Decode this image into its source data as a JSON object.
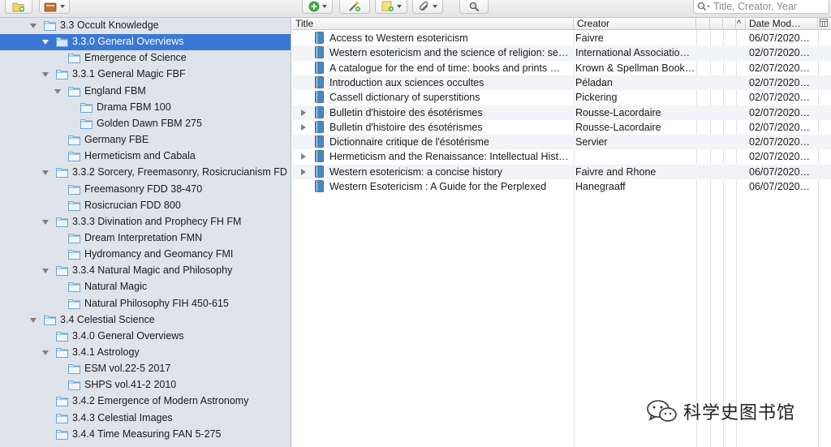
{
  "toolbar": {
    "search_placeholder": "Title, Creator, Year",
    "icons": [
      "new-collection-icon",
      "new-library-icon",
      "new-item-icon",
      "add-by-identifier-icon",
      "new-note-icon",
      "add-attachment-icon",
      "locate-icon",
      "search-icon"
    ]
  },
  "tree": {
    "items": [
      {
        "label": "3.3 Occult Knowledge",
        "depth": 1,
        "expanded": true,
        "selected": false
      },
      {
        "label": "3.3.0 General Overviews",
        "depth": 2,
        "expanded": true,
        "selected": true
      },
      {
        "label": "Emergence of Science",
        "depth": 3,
        "expanded": null,
        "selected": false
      },
      {
        "label": "3.3.1 General Magic FBF",
        "depth": 2,
        "expanded": true,
        "selected": false
      },
      {
        "label": "England FBM",
        "depth": 3,
        "expanded": true,
        "selected": false
      },
      {
        "label": "Drama FBM 100",
        "depth": 4,
        "expanded": null,
        "selected": false
      },
      {
        "label": "Golden Dawn FBM 275",
        "depth": 4,
        "expanded": null,
        "selected": false
      },
      {
        "label": "Germany FBE",
        "depth": 3,
        "expanded": null,
        "selected": false
      },
      {
        "label": "Hermeticism and Cabala",
        "depth": 3,
        "expanded": null,
        "selected": false
      },
      {
        "label": "3.3.2 Sorcery, Freemasonry, Rosicrucianism FD",
        "depth": 2,
        "expanded": true,
        "selected": false
      },
      {
        "label": "Freemasonry FDD 38-470",
        "depth": 3,
        "expanded": null,
        "selected": false
      },
      {
        "label": "Rosicrucian FDD 800",
        "depth": 3,
        "expanded": null,
        "selected": false
      },
      {
        "label": "3.3.3 Divination and Prophecy FH FM",
        "depth": 2,
        "expanded": true,
        "selected": false
      },
      {
        "label": "Dream Interpretation FMN",
        "depth": 3,
        "expanded": null,
        "selected": false
      },
      {
        "label": "Hydromancy and Geomancy FMI",
        "depth": 3,
        "expanded": null,
        "selected": false
      },
      {
        "label": "3.3.4 Natural Magic and Philosophy",
        "depth": 2,
        "expanded": true,
        "selected": false
      },
      {
        "label": "Natural Magic",
        "depth": 3,
        "expanded": null,
        "selected": false
      },
      {
        "label": "Natural Philosophy FIH 450-615",
        "depth": 3,
        "expanded": null,
        "selected": false
      },
      {
        "label": "3.4 Celestial Science",
        "depth": 1,
        "expanded": true,
        "selected": false
      },
      {
        "label": "3.4.0 General Overviews",
        "depth": 2,
        "expanded": null,
        "selected": false
      },
      {
        "label": "3.4.1 Astrology",
        "depth": 2,
        "expanded": true,
        "selected": false
      },
      {
        "label": "ESM vol.22-5 2017",
        "depth": 3,
        "expanded": null,
        "selected": false
      },
      {
        "label": "SHPS vol.41-2 2010",
        "depth": 3,
        "expanded": null,
        "selected": false
      },
      {
        "label": "3.4.2 Emergence of Modern Astronomy",
        "depth": 2,
        "expanded": null,
        "selected": false
      },
      {
        "label": "3.4.3 Celestial Images",
        "depth": 2,
        "expanded": null,
        "selected": false
      },
      {
        "label": "3.4.4 Time Measuring FAN 5-275",
        "depth": 2,
        "expanded": null,
        "selected": false
      }
    ]
  },
  "list": {
    "columns": {
      "title": "Title",
      "creator": "Creator",
      "date_modified": "Date Mod…",
      "sort_indicator": "^"
    },
    "rows": [
      {
        "title": "Access to Western esotericism",
        "creator": "Faivre",
        "date": "06/07/2020…",
        "has_children": false
      },
      {
        "title": "Western esotericism and the science of religion: se…",
        "creator": "International Associatio…",
        "date": "02/07/2020…",
        "has_children": false
      },
      {
        "title": "A catalogue for the end of time: books and prints …",
        "creator": "Krown & Spellman Book…",
        "date": "02/07/2020…",
        "has_children": false
      },
      {
        "title": "Introduction aux sciences occultes",
        "creator": "Péladan",
        "date": "02/07/2020…",
        "has_children": false
      },
      {
        "title": "Cassell dictionary of superstitions",
        "creator": "Pickering",
        "date": "02/07/2020…",
        "has_children": false
      },
      {
        "title": "Bulletin d'histoire des ésotérismes",
        "creator": "Rousse-Lacordaire",
        "date": "02/07/2020…",
        "has_children": true
      },
      {
        "title": "Bulletin d'histoire des ésotérismes",
        "creator": "Rousse-Lacordaire",
        "date": "02/07/2020…",
        "has_children": true
      },
      {
        "title": "Dictionnaire critique de l'ésotérisme",
        "creator": "Servier",
        "date": "02/07/2020…",
        "has_children": false
      },
      {
        "title": "Hermeticism and the Renaissance: Intellectual Hist…",
        "creator": "",
        "date": "02/07/2020…",
        "has_children": true
      },
      {
        "title": "Western esotericism: a concise history",
        "creator": "Faivre and Rhone",
        "date": "06/07/2020…",
        "has_children": true
      },
      {
        "title": "Western Esotericism : A Guide for the Perplexed",
        "creator": "Hanegraaff",
        "date": "06/07/2020…",
        "has_children": false
      }
    ]
  },
  "watermark": {
    "text": "科学史图书馆",
    "icon": "wechat-icon"
  },
  "colors": {
    "selection": "#3a78d3",
    "sidebar_bg": "#dfe4ea",
    "folder": "#6aa6d6",
    "book": "#4a86c5"
  }
}
